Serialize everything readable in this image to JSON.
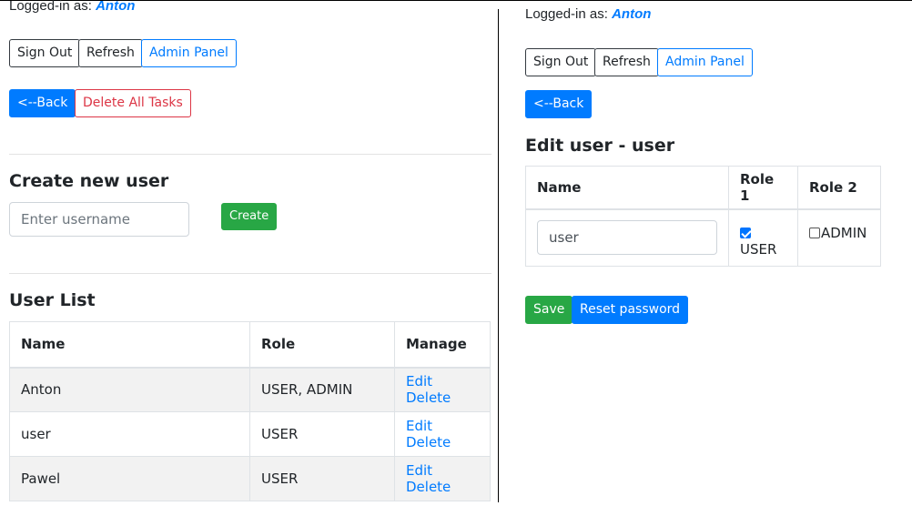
{
  "left": {
    "logged_label": "Logged-in as:",
    "logged_user": "Anton",
    "buttons": {
      "sign_out": "Sign Out",
      "refresh": "Refresh",
      "admin_panel": "Admin Panel",
      "back": "<--Back",
      "delete_all": "Delete All Tasks"
    },
    "create_title": "Create new user",
    "username_placeholder": "Enter username",
    "create_button": "Create",
    "user_list_title": "User List",
    "table": {
      "headers": [
        "Name",
        "Role",
        "Manage"
      ],
      "rows": [
        {
          "name": "Anton",
          "role": "USER, ADMIN",
          "edit": "Edit",
          "delete": "Delete"
        },
        {
          "name": "user",
          "role": "USER",
          "edit": "Edit",
          "delete": "Delete"
        },
        {
          "name": "Pawel",
          "role": "USER",
          "edit": "Edit",
          "delete": "Delete"
        }
      ]
    }
  },
  "right": {
    "logged_label": "Logged-in as:",
    "logged_user": "Anton",
    "buttons": {
      "sign_out": "Sign Out",
      "refresh": "Refresh",
      "admin_panel": "Admin Panel",
      "back": "<--Back"
    },
    "edit_title": "Edit user - user",
    "table": {
      "headers": [
        "Name",
        "Role 1",
        "Role 2"
      ],
      "name_value": "user",
      "role1_label": "USER",
      "role1_checked": true,
      "role2_label": "ADMIN",
      "role2_checked": false
    },
    "save_button": "Save",
    "reset_button": "Reset password"
  },
  "colors": {
    "primary": "#007bff",
    "success": "#28a745",
    "danger": "#dc3545"
  }
}
